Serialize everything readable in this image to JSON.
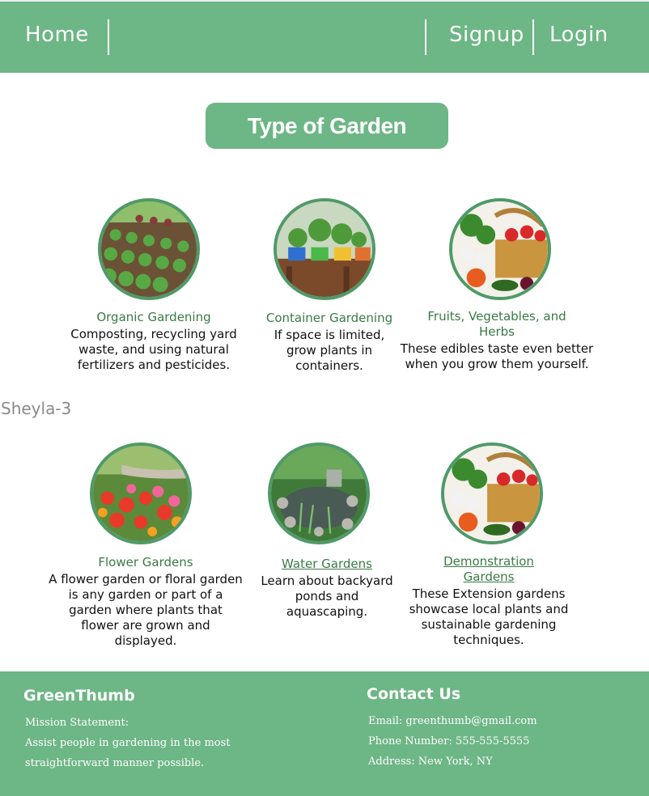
{
  "nav": {
    "home": "Home",
    "signup": "Signup",
    "login": "Login"
  },
  "heading": "Type of Garden",
  "watermark": "Sheyla-3",
  "cards": [
    {
      "title": "Organic Gardening",
      "desc": "Composting, recycling yard waste, and using natural fertilizers and pesticides.",
      "image": "garden-rows-image"
    },
    {
      "title": "Container Gardening",
      "desc": "If space is limited, grow plants in containers.",
      "image": "container-pots-image"
    },
    {
      "title": "Fruits, Vegetables, and Herbs",
      "desc": "These edibles taste even better when you grow them yourself.",
      "image": "vegetable-basket-image"
    },
    {
      "title": "Flower Gardens",
      "desc": "A flower garden or floral garden is any garden or part of a garden where plants that flower are grown and displayed.",
      "image": "flower-bed-image"
    },
    {
      "title": "Water Gardens",
      "desc": "Learn about backyard ponds and aquascaping.",
      "image": "pond-image"
    },
    {
      "title": "Demonstration Gardens",
      "desc": "These Extension gardens showcase local plants and sustainable gardening techniques.",
      "image": "vegetable-basket-image"
    }
  ],
  "footer": {
    "brand": "GreenThumb",
    "mission_label": "Mission Statement:",
    "mission_line1": "Assist people in gardening in the most",
    "mission_line2": "straightforward manner possible.",
    "contact_heading": "Contact Us",
    "email": "Email: greenthumb@gmail.com",
    "phone": "Phone Number: 555-555-5555",
    "address": "Address: New York, NY"
  },
  "colors": {
    "brand_green": "#6db685",
    "ring_green": "#4f9a68",
    "title_green": "#3a7a45"
  }
}
